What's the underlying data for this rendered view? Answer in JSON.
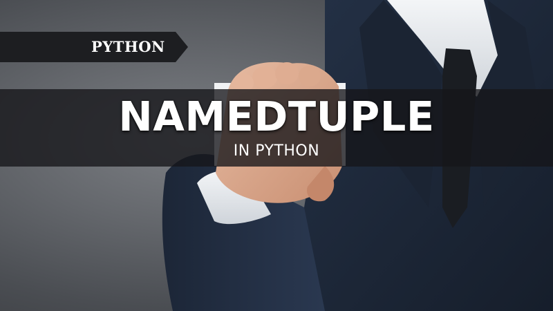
{
  "banner": {
    "tag": "PYTHON"
  },
  "hero": {
    "title": "NAMEDTUPLE",
    "subtitle": "IN PYTHON"
  },
  "colors": {
    "banner_bg": "#1d1e21",
    "title_band_bg": "#161619",
    "text": "#ffffff",
    "suit": "#1f2a3a",
    "shirt": "#e9ecef",
    "skin": "#d9a88c"
  }
}
